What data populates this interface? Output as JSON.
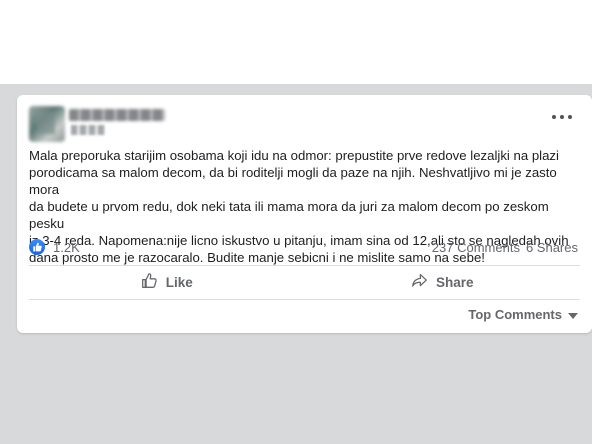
{
  "post": {
    "text": "Mala preporuka starijim osobama koji idu na odmor: prepustite prve redove lezaljki na plazi\nporodicama sa malom decom, da bi roditelji mogli da paze na njih. Neshvatljivo mi je zasto mora\nda budete u prvom redu, dok neki tata ili mama mora da juri za malom decom po zeskom pesku\niz 3-4 reda. Napomena:nije licno iskustvo u pitanju, imam sina od 12,ali sto se nagledah ovih\ndana prosto me je razocaralo. Budite manje sebicni i ne mislite samo na sebe!"
  },
  "stats": {
    "reactions": "1.2K",
    "comments": "237 Comments",
    "shares": "6 Shares"
  },
  "actions": {
    "like_label": "Like",
    "share_label": "Share"
  },
  "comments": {
    "sort_label": "Top Comments"
  },
  "icons": {
    "reaction": "like-reaction-icon",
    "like": "thumbs-up-icon",
    "share": "share-arrow-icon",
    "more": "more-options-icon",
    "sort": "caret-down-icon"
  },
  "colors": {
    "page_background": "#d8d9db",
    "card": "#ffffff",
    "text": "#1c1e21",
    "secondary_text": "#65676b",
    "like_blue": "#1877f2"
  }
}
